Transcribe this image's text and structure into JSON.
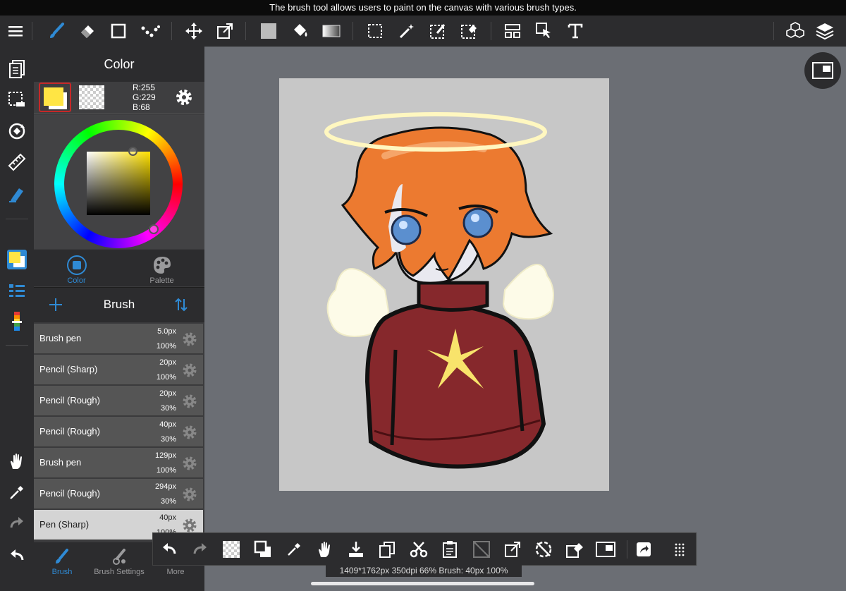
{
  "tooltip": "The brush tool allows users to paint on the canvas with various brush types.",
  "colors": {
    "accent": "#2f8ad4",
    "foreground": "#ffe544",
    "panel": "#3b3b3d",
    "bar": "#2c2c2e"
  },
  "color_panel": {
    "title": "Color",
    "rgb": {
      "r": "R:255",
      "g": "G:229",
      "b": "B:68"
    },
    "tabs": [
      "Color",
      "Palette"
    ]
  },
  "brush_panel": {
    "title": "Brush",
    "items": [
      {
        "name": "Brush pen",
        "size": "5.0px",
        "opacity": "100%"
      },
      {
        "name": "Pencil (Sharp)",
        "size": "20px",
        "opacity": "100%"
      },
      {
        "name": "Pencil (Rough)",
        "size": "20px",
        "opacity": "30%"
      },
      {
        "name": "Pencil (Rough)",
        "size": "40px",
        "opacity": "30%"
      },
      {
        "name": "Brush pen",
        "size": "129px",
        "opacity": "100%"
      },
      {
        "name": "Pencil (Rough)",
        "size": "294px",
        "opacity": "30%"
      },
      {
        "name": "Pen (Sharp)",
        "size": "40px",
        "opacity": "100%"
      }
    ],
    "bottom_tabs": [
      "Brush",
      "Brush Settings",
      "More"
    ]
  },
  "status": "1409*1762px 350dpi 66% Brush: 40px 100%",
  "icons": {
    "top_toolbar": [
      "menu-icon",
      "brush-icon",
      "eraser-icon",
      "shape-icon",
      "dot-icon",
      "move-icon",
      "transform-icon",
      "fill-color-icon",
      "bucket-icon",
      "gradient-icon",
      "select-icon",
      "magic-wand-icon",
      "select-pen-icon",
      "select-eraser-icon",
      "layout-icon",
      "select-arrow-icon",
      "text-icon",
      "3d-icon",
      "layers-icon"
    ],
    "left_toolbar": [
      "pages-icon",
      "selection-icon",
      "rotate-icon",
      "ruler-icon",
      "pen-icon",
      "color-swatch-icon",
      "brush-list-icon",
      "color-bar-icon",
      "hand-icon",
      "eyedropper-icon",
      "redo-icon",
      "undo-icon"
    ],
    "float_toolbar": [
      "undo-icon",
      "redo-icon",
      "transparent-icon",
      "swap-colors-icon",
      "eyedropper-icon",
      "hand-icon",
      "save-icon",
      "copy-icon",
      "cut-icon",
      "paste-icon",
      "clear-icon",
      "transform-icon",
      "snap-icon",
      "eraser-icon",
      "canvas-icon",
      "share-icon",
      "grip-icon"
    ]
  }
}
